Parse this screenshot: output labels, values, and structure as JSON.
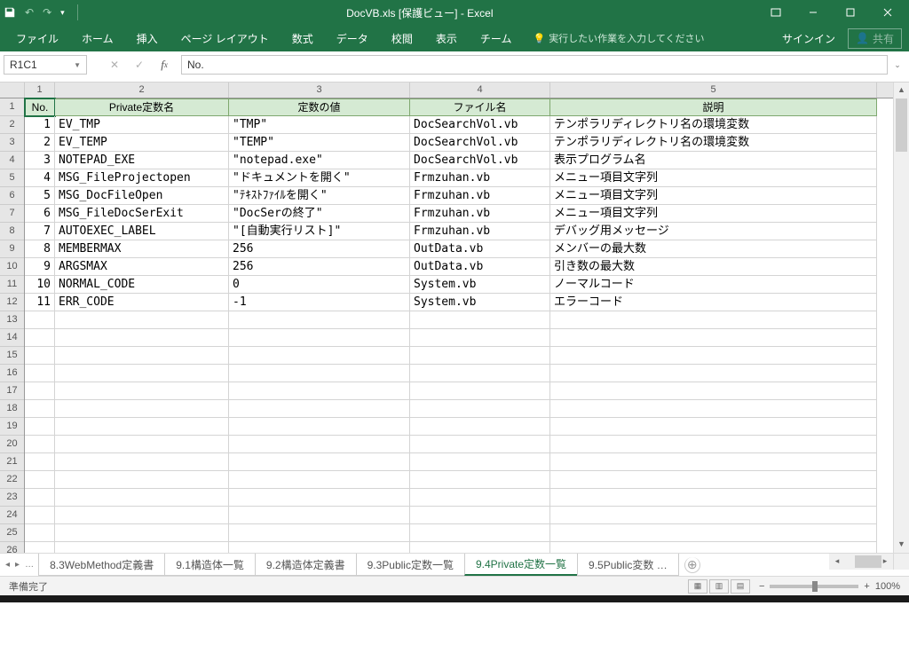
{
  "title": "DocVB.xls  [保護ビュー] - Excel",
  "qat": {
    "undo": "↶",
    "redo": "↷"
  },
  "ribbon": {
    "tabs": [
      "ファイル",
      "ホーム",
      "挿入",
      "ページ レイアウト",
      "数式",
      "データ",
      "校閲",
      "表示",
      "チーム"
    ],
    "tell_me": "実行したい作業を入力してください",
    "signin": "サインイン",
    "share": "共有"
  },
  "formula_bar": {
    "namebox": "R1C1",
    "value": "No."
  },
  "columns": [
    "1",
    "2",
    "3",
    "4",
    "5"
  ],
  "row_count_visible": 27,
  "table": {
    "headers": [
      "No.",
      "Private定数名",
      "定数の値",
      "ファイル名",
      "説明"
    ],
    "rows": [
      {
        "no": "1",
        "name": "EV_TMP",
        "val": "\"TMP\"",
        "file": "DocSearchVol.vb",
        "desc": "テンポラリディレクトリ名の環境変数"
      },
      {
        "no": "2",
        "name": "EV_TEMP",
        "val": "\"TEMP\"",
        "file": "DocSearchVol.vb",
        "desc": "テンポラリディレクトリ名の環境変数"
      },
      {
        "no": "3",
        "name": "NOTEPAD_EXE",
        "val": "\"notepad.exe\"",
        "file": "DocSearchVol.vb",
        "desc": "表示プログラム名"
      },
      {
        "no": "4",
        "name": "MSG_FileProjectopen",
        "val": "\"ドキュメントを開く\"",
        "file": "Frmzuhan.vb",
        "desc": "メニュー項目文字列"
      },
      {
        "no": "5",
        "name": "MSG_DocFileOpen",
        "val": "\"ﾃｷｽﾄﾌｧｲﾙを開く\"",
        "file": "Frmzuhan.vb",
        "desc": "メニュー項目文字列"
      },
      {
        "no": "6",
        "name": "MSG_FileDocSerExit",
        "val": "\"DocSerの終了\"",
        "file": "Frmzuhan.vb",
        "desc": "メニュー項目文字列"
      },
      {
        "no": "7",
        "name": "AUTOEXEC_LABEL",
        "val": "\"[自動実行リスト]\"",
        "file": "Frmzuhan.vb",
        "desc": "デバッグ用メッセージ"
      },
      {
        "no": "8",
        "name": "MEMBERMAX",
        "val": "256",
        "file": "OutData.vb",
        "desc": "メンバーの最大数"
      },
      {
        "no": "9",
        "name": "ARGSMAX",
        "val": "256",
        "file": "OutData.vb",
        "desc": "引き数の最大数"
      },
      {
        "no": "10",
        "name": "NORMAL_CODE",
        "val": "0",
        "file": "System.vb",
        "desc": "ノーマルコード"
      },
      {
        "no": "11",
        "name": "ERR_CODE",
        "val": "-1",
        "file": "System.vb",
        "desc": "エラーコード"
      }
    ]
  },
  "sheet_tabs": [
    "8.3WebMethod定義書",
    "9.1構造体一覧",
    "9.2構造体定義書",
    "9.3Public定数一覧",
    "9.4Private定数一覧",
    "9.5Public変数 …"
  ],
  "active_sheet_tab": 4,
  "status": {
    "left": "準備完了",
    "zoom": "100%"
  }
}
